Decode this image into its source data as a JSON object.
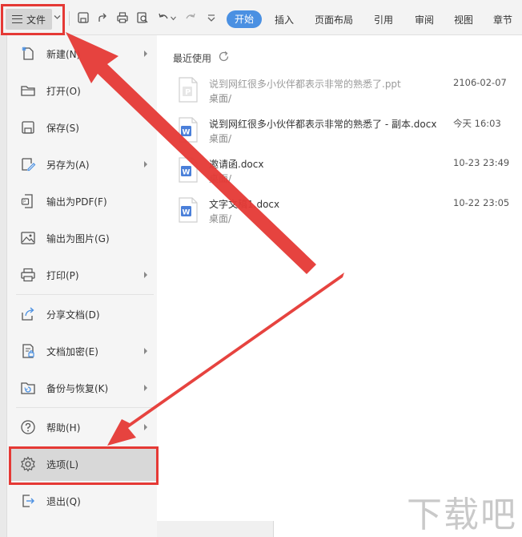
{
  "toolbar": {
    "file_label": "文件",
    "tabs": [
      "开始",
      "插入",
      "页面布局",
      "引用",
      "审阅",
      "视图",
      "章节"
    ],
    "icons": [
      "save-icon",
      "export-icon",
      "print-icon",
      "print-preview-icon",
      "undo-icon",
      "redo-icon",
      "more-icon"
    ]
  },
  "menu": {
    "items": [
      {
        "label": "新建(N)",
        "icon": "new-document-icon",
        "has_submenu": true
      },
      {
        "label": "打开(O)",
        "icon": "folder-icon",
        "has_submenu": false
      },
      {
        "label": "保存(S)",
        "icon": "save-icon",
        "has_submenu": false
      },
      {
        "label": "另存为(A)",
        "icon": "save-as-icon",
        "has_submenu": true
      },
      {
        "label": "输出为PDF(F)",
        "icon": "pdf-icon",
        "has_submenu": false
      },
      {
        "label": "输出为图片(G)",
        "icon": "image-icon",
        "has_submenu": false
      },
      {
        "label": "打印(P)",
        "icon": "print-icon",
        "has_submenu": true
      },
      {
        "label": "分享文档(D)",
        "icon": "share-icon",
        "has_submenu": false
      },
      {
        "label": "文档加密(E)",
        "icon": "encrypt-icon",
        "has_submenu": true
      },
      {
        "label": "备份与恢复(K)",
        "icon": "backup-icon",
        "has_submenu": true
      },
      {
        "label": "帮助(H)",
        "icon": "help-icon",
        "has_submenu": true
      },
      {
        "label": "选项(L)",
        "icon": "gear-icon",
        "has_submenu": false
      },
      {
        "label": "退出(Q)",
        "icon": "exit-icon",
        "has_submenu": false
      }
    ]
  },
  "recent": {
    "title": "最近使用",
    "files": [
      {
        "name": "说到网红很多小伙伴都表示非常的熟悉了.ppt",
        "path": "桌面/",
        "time": "2106-02-07",
        "type": "ppt"
      },
      {
        "name": "说到网红很多小伙伴都表示非常的熟悉了 - 副本.docx",
        "path": "桌面/",
        "time": "今天 16:03",
        "type": "docx"
      },
      {
        "name": "邀请函.docx",
        "path": "桌面/",
        "time": "10-23 23:49",
        "type": "docx"
      },
      {
        "name": "文字文稿1.docx",
        "path": "桌面/",
        "time": "10-22 23:05",
        "type": "docx"
      }
    ]
  },
  "colors": {
    "accent": "#4a90e2",
    "annotation": "#e53935",
    "word_blue": "#4a7fd9"
  }
}
